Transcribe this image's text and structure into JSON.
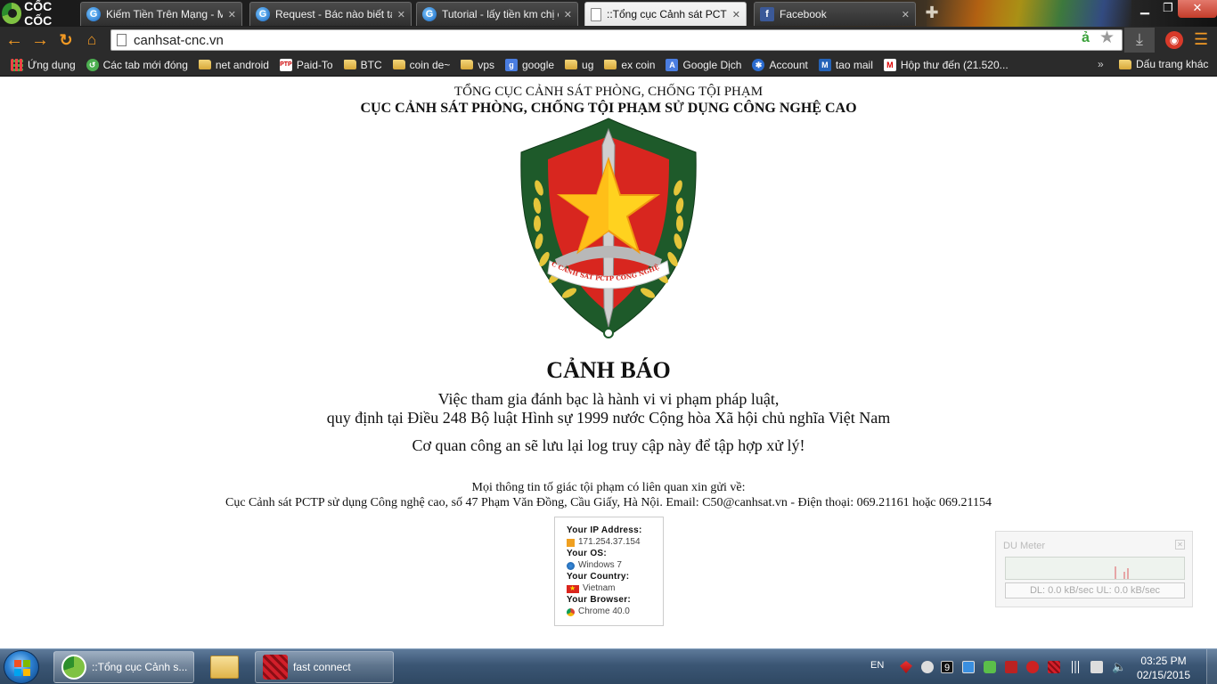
{
  "browser": {
    "brand": "CỐC CỐC",
    "tabs": [
      {
        "title": "Kiếm Tiền Trên Mạng - M",
        "icon": "globe-icon",
        "active": false
      },
      {
        "title": "Request - Bác nào biết tạo",
        "icon": "globe-icon",
        "active": false
      },
      {
        "title": "Tutorial - lấy tiền km chị c",
        "icon": "globe-icon",
        "active": false
      },
      {
        "title": "::Tổng cục Cảnh sát PCTP",
        "icon": "page-icon",
        "active": true
      },
      {
        "title": "Facebook",
        "icon": "facebook-icon",
        "active": false
      }
    ],
    "url": "canhsat-cnc.vn",
    "bookmarks": [
      {
        "label": "Ứng dụng",
        "icon": "apps-icon"
      },
      {
        "label": "Các tab mới đóng",
        "icon": "recent-tabs-icon"
      },
      {
        "label": "net android",
        "icon": "folder-icon"
      },
      {
        "label": "Paid-To",
        "icon": "ptp-icon"
      },
      {
        "label": "BTC",
        "icon": "folder-icon"
      },
      {
        "label": "coin de~",
        "icon": "folder-icon"
      },
      {
        "label": "vps",
        "icon": "folder-icon"
      },
      {
        "label": "google",
        "icon": "google-icon"
      },
      {
        "label": "ug",
        "icon": "folder-icon"
      },
      {
        "label": "ex coin",
        "icon": "folder-icon"
      },
      {
        "label": "Google Dịch",
        "icon": "google-translate-icon"
      },
      {
        "label": "Account",
        "icon": "account-icon"
      },
      {
        "label": "tao mail",
        "icon": "m-icon"
      },
      {
        "label": "Hộp thư đến (21.520...",
        "icon": "gmail-icon"
      }
    ],
    "bookmarks_more": "»",
    "other_bookmarks": "Dấu trang khác"
  },
  "page": {
    "org_line1": "TỔNG CỤC CẢNH SÁT PHÒNG, CHỐNG TỘI PHẠM",
    "org_line2": "CỤC CẢNH SÁT PHÒNG, CHỐNG TỘI PHẠM SỬ DỤNG CÔNG NGHỆ CAO",
    "emblem_ribbon": "CỤC CẢNH SÁT PCTP CÔNG NGHỆ CAO",
    "warning_title": "CẢNH BÁO",
    "warning_line1": "Việc tham gia đánh bạc là hành vi vi phạm pháp luật,",
    "warning_line2": "quy định tại Điều 248 Bộ luật Hình sự 1999 nước Cộng hòa Xã hội chủ nghĩa Việt Nam",
    "warning_line3": "Cơ quan công an sẽ lưu lại log truy cập này để tập hợp xử lý!",
    "contact_line1": "Mọi thông tin tố giác tội phạm có liên quan xin gửi về:",
    "contact_line2": "Cục Cảnh sát PCTP sử dụng Công nghệ cao, số 47 Phạm Văn Đồng, Cầu Giấy, Hà Nội. Email: C50@canhsat.vn - Điện thoại: 069.21161 hoặc 069.21154",
    "visitor": {
      "ip_label": "Your IP Address:",
      "ip_value": "171.254.37.154",
      "os_label": "Your OS:",
      "os_value": "Windows 7",
      "country_label": "Your Country:",
      "country_value": "Vietnam",
      "browser_label": "Your Browser:",
      "browser_value": "Chrome 40.0"
    }
  },
  "du_meter": {
    "title": "DU Meter",
    "rates": "DL: 0.0 kB/sec  UL: 0.0 kB/sec"
  },
  "taskbar": {
    "items": [
      {
        "label": "::Tổng cục Cảnh s...",
        "icon": "coccoc-icon"
      },
      {
        "label": "",
        "icon": "folder-icon"
      },
      {
        "label": "fast connect",
        "icon": "fast-connect-icon"
      }
    ],
    "lang": "EN",
    "tray_badge": "9",
    "time": "03:25 PM",
    "date": "02/15/2015"
  },
  "colors": {
    "accent_orange": "#f39a24",
    "shield_green": "#1e5a2a",
    "shield_red": "#d8261f",
    "star_yellow": "#ffd21f"
  }
}
